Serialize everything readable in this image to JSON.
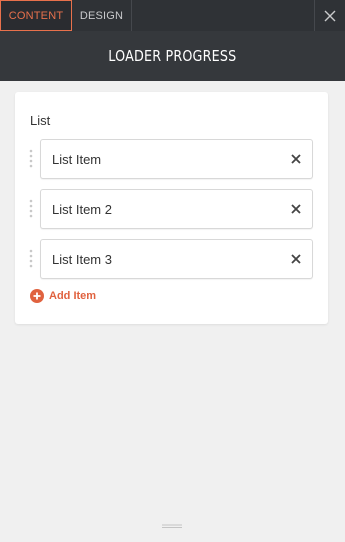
{
  "tabs": [
    {
      "label": "CONTENT",
      "active": true
    },
    {
      "label": "DESIGN",
      "active": false
    }
  ],
  "close_icon": "close-icon",
  "header": {
    "title": "LOADER PROGRESS"
  },
  "list": {
    "label": "List",
    "items": [
      {
        "label": "List Item"
      },
      {
        "label": "List Item 2"
      },
      {
        "label": "List Item 3"
      }
    ],
    "add_label": "Add Item"
  },
  "colors": {
    "accent": "#e8714c",
    "topbar": "#2f3236",
    "header": "#35383c",
    "background": "#f0f0f0"
  }
}
